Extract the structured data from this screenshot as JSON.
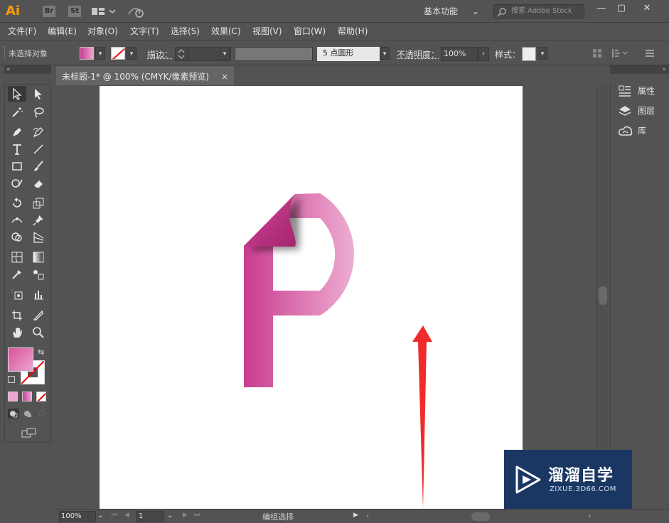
{
  "app": {
    "logo": "Ai",
    "bridge": "Br",
    "stock": "St",
    "workspace": "基本功能",
    "search_placeholder": "搜索 Adobe Stock",
    "window_buttons": {
      "minimize": "—",
      "maximize": "▢",
      "close": "✕"
    }
  },
  "menu": [
    "文件(F)",
    "编辑(E)",
    "对象(O)",
    "文字(T)",
    "选择(S)",
    "效果(C)",
    "视图(V)",
    "窗口(W)",
    "帮助(H)"
  ],
  "control": {
    "selection_label": "未选择对象",
    "stroke_label": "描边：",
    "brush_value": "5 点圆形",
    "opacity_label": "不透明度：",
    "opacity_value": "100%",
    "style_label": "样式："
  },
  "document": {
    "tab_title": "未标题-1* @ 100% (CMYK/像素预览)",
    "close": "×"
  },
  "right_panel": {
    "items": [
      {
        "label": "属性",
        "icon": "properties-icon"
      },
      {
        "label": "图层",
        "icon": "layers-icon"
      },
      {
        "label": "库",
        "icon": "libraries-icon"
      }
    ]
  },
  "status": {
    "zoom": "100%",
    "page": "1",
    "tool_status": "编组选择"
  },
  "watermark": {
    "title": "溜溜自学",
    "subtitle": "ZIXUE.3D66.COM"
  },
  "colors": {
    "fill_gradient_start": "#c93c8f",
    "fill_gradient_end": "#eeaed2",
    "annotation_arrow": "#f02b2b",
    "watermark_bg": "#1a3763"
  }
}
